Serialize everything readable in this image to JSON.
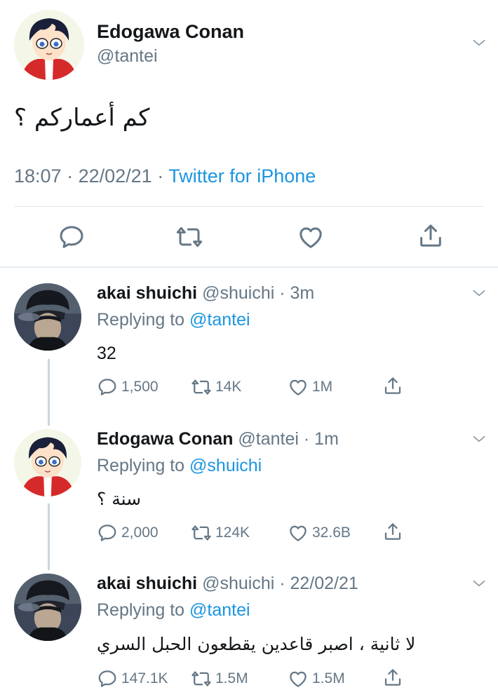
{
  "main_tweet": {
    "author_name": "Edogawa Conan",
    "handle": "@tantei",
    "text": "كم أعماركم ؟",
    "time": "18:07",
    "date": "22/02/21",
    "source": "Twitter for iPhone",
    "actions": [
      "reply-icon",
      "retweet-icon",
      "like-icon",
      "share-icon"
    ]
  },
  "replies": [
    {
      "author_name": "akai shuichi",
      "handle_time": "@shuichi · 3m",
      "replying_prefix": "Replying to",
      "replying_to": "@tantei",
      "text": "32",
      "stats": {
        "replies": "1,500",
        "retweets": "14K",
        "likes": "1M"
      }
    },
    {
      "author_name": "Edogawa Conan",
      "handle_time": "@tantei · 1m",
      "replying_prefix": "Replying to",
      "replying_to": "@shuichi",
      "text": "سنة ؟",
      "stats": {
        "replies": "2,000",
        "retweets": "124K",
        "likes": "32.6B"
      }
    },
    {
      "author_name": "akai shuichi",
      "handle_time": "@shuichi · 22/02/21",
      "replying_prefix": "Replying to",
      "replying_to": "@tantei",
      "text": "لا ثانية ، اصبر قاعدين يقطعون الحبل السري",
      "stats": {
        "replies": "147.1K",
        "retweets": "1.5M",
        "likes": "1.5M"
      }
    }
  ],
  "colors": {
    "text": "#14171a",
    "secondary": "#657786",
    "link": "#1b95e0",
    "divider": "#e1e8ed",
    "thread_line": "#ccd6dd"
  }
}
